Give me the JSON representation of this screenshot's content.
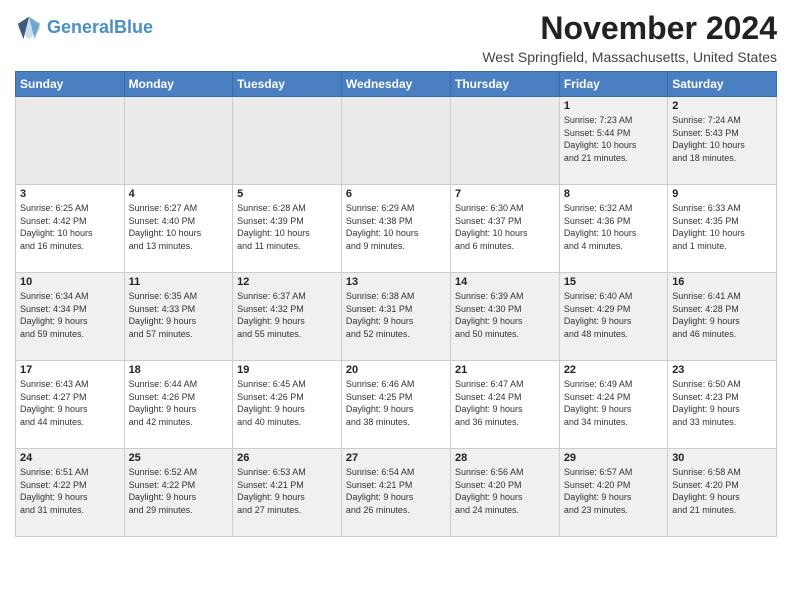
{
  "header": {
    "logo_line1": "General",
    "logo_line2": "Blue",
    "month_title": "November 2024",
    "location": "West Springfield, Massachusetts, United States"
  },
  "days_of_week": [
    "Sunday",
    "Monday",
    "Tuesday",
    "Wednesday",
    "Thursday",
    "Friday",
    "Saturday"
  ],
  "weeks": [
    [
      {
        "day": "",
        "info": ""
      },
      {
        "day": "",
        "info": ""
      },
      {
        "day": "",
        "info": ""
      },
      {
        "day": "",
        "info": ""
      },
      {
        "day": "",
        "info": ""
      },
      {
        "day": "1",
        "info": "Sunrise: 7:23 AM\nSunset: 5:44 PM\nDaylight: 10 hours\nand 21 minutes."
      },
      {
        "day": "2",
        "info": "Sunrise: 7:24 AM\nSunset: 5:43 PM\nDaylight: 10 hours\nand 18 minutes."
      }
    ],
    [
      {
        "day": "3",
        "info": "Sunrise: 6:25 AM\nSunset: 4:42 PM\nDaylight: 10 hours\nand 16 minutes."
      },
      {
        "day": "4",
        "info": "Sunrise: 6:27 AM\nSunset: 4:40 PM\nDaylight: 10 hours\nand 13 minutes."
      },
      {
        "day": "5",
        "info": "Sunrise: 6:28 AM\nSunset: 4:39 PM\nDaylight: 10 hours\nand 11 minutes."
      },
      {
        "day": "6",
        "info": "Sunrise: 6:29 AM\nSunset: 4:38 PM\nDaylight: 10 hours\nand 9 minutes."
      },
      {
        "day": "7",
        "info": "Sunrise: 6:30 AM\nSunset: 4:37 PM\nDaylight: 10 hours\nand 6 minutes."
      },
      {
        "day": "8",
        "info": "Sunrise: 6:32 AM\nSunset: 4:36 PM\nDaylight: 10 hours\nand 4 minutes."
      },
      {
        "day": "9",
        "info": "Sunrise: 6:33 AM\nSunset: 4:35 PM\nDaylight: 10 hours\nand 1 minute."
      }
    ],
    [
      {
        "day": "10",
        "info": "Sunrise: 6:34 AM\nSunset: 4:34 PM\nDaylight: 9 hours\nand 59 minutes."
      },
      {
        "day": "11",
        "info": "Sunrise: 6:35 AM\nSunset: 4:33 PM\nDaylight: 9 hours\nand 57 minutes."
      },
      {
        "day": "12",
        "info": "Sunrise: 6:37 AM\nSunset: 4:32 PM\nDaylight: 9 hours\nand 55 minutes."
      },
      {
        "day": "13",
        "info": "Sunrise: 6:38 AM\nSunset: 4:31 PM\nDaylight: 9 hours\nand 52 minutes."
      },
      {
        "day": "14",
        "info": "Sunrise: 6:39 AM\nSunset: 4:30 PM\nDaylight: 9 hours\nand 50 minutes."
      },
      {
        "day": "15",
        "info": "Sunrise: 6:40 AM\nSunset: 4:29 PM\nDaylight: 9 hours\nand 48 minutes."
      },
      {
        "day": "16",
        "info": "Sunrise: 6:41 AM\nSunset: 4:28 PM\nDaylight: 9 hours\nand 46 minutes."
      }
    ],
    [
      {
        "day": "17",
        "info": "Sunrise: 6:43 AM\nSunset: 4:27 PM\nDaylight: 9 hours\nand 44 minutes."
      },
      {
        "day": "18",
        "info": "Sunrise: 6:44 AM\nSunset: 4:26 PM\nDaylight: 9 hours\nand 42 minutes."
      },
      {
        "day": "19",
        "info": "Sunrise: 6:45 AM\nSunset: 4:26 PM\nDaylight: 9 hours\nand 40 minutes."
      },
      {
        "day": "20",
        "info": "Sunrise: 6:46 AM\nSunset: 4:25 PM\nDaylight: 9 hours\nand 38 minutes."
      },
      {
        "day": "21",
        "info": "Sunrise: 6:47 AM\nSunset: 4:24 PM\nDaylight: 9 hours\nand 36 minutes."
      },
      {
        "day": "22",
        "info": "Sunrise: 6:49 AM\nSunset: 4:24 PM\nDaylight: 9 hours\nand 34 minutes."
      },
      {
        "day": "23",
        "info": "Sunrise: 6:50 AM\nSunset: 4:23 PM\nDaylight: 9 hours\nand 33 minutes."
      }
    ],
    [
      {
        "day": "24",
        "info": "Sunrise: 6:51 AM\nSunset: 4:22 PM\nDaylight: 9 hours\nand 31 minutes."
      },
      {
        "day": "25",
        "info": "Sunrise: 6:52 AM\nSunset: 4:22 PM\nDaylight: 9 hours\nand 29 minutes."
      },
      {
        "day": "26",
        "info": "Sunrise: 6:53 AM\nSunset: 4:21 PM\nDaylight: 9 hours\nand 27 minutes."
      },
      {
        "day": "27",
        "info": "Sunrise: 6:54 AM\nSunset: 4:21 PM\nDaylight: 9 hours\nand 26 minutes."
      },
      {
        "day": "28",
        "info": "Sunrise: 6:56 AM\nSunset: 4:20 PM\nDaylight: 9 hours\nand 24 minutes."
      },
      {
        "day": "29",
        "info": "Sunrise: 6:57 AM\nSunset: 4:20 PM\nDaylight: 9 hours\nand 23 minutes."
      },
      {
        "day": "30",
        "info": "Sunrise: 6:58 AM\nSunset: 4:20 PM\nDaylight: 9 hours\nand 21 minutes."
      }
    ]
  ]
}
